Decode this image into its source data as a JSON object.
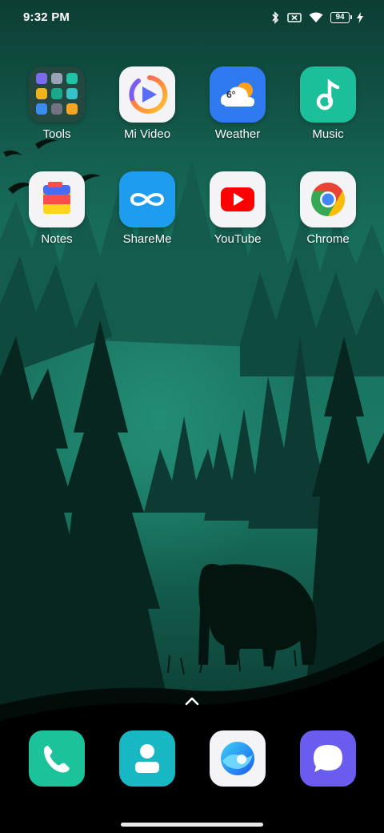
{
  "status_bar": {
    "time": "9:32 PM",
    "battery_level": "94",
    "icons": [
      "bluetooth-icon",
      "no-sim-icon",
      "wifi-icon",
      "battery-icon",
      "charging-icon"
    ]
  },
  "home": {
    "apps": [
      {
        "label": "Tools",
        "icon": "folder-icon"
      },
      {
        "label": "Mi Video",
        "icon": "mi-video-icon"
      },
      {
        "label": "Weather",
        "icon": "weather-icon",
        "temp": "6°"
      },
      {
        "label": "Music",
        "icon": "music-icon"
      },
      {
        "label": "Notes",
        "icon": "notes-icon"
      },
      {
        "label": "ShareMe",
        "icon": "shareme-icon"
      },
      {
        "label": "YouTube",
        "icon": "youtube-icon"
      },
      {
        "label": "Chrome",
        "icon": "chrome-icon"
      }
    ]
  },
  "dock": {
    "apps": [
      {
        "icon": "phone-icon"
      },
      {
        "icon": "contacts-icon"
      },
      {
        "icon": "browser-icon"
      },
      {
        "icon": "messages-icon"
      }
    ]
  },
  "colors": {
    "wallpaper_green": "#0e5a4a",
    "music": "#1bbf9a",
    "shareme": "#1e9cf0",
    "weather": "#2f7af0",
    "youtube_red": "#ff0000",
    "phone": "#1cc39a",
    "contacts": "#18b7c4",
    "messages": "#6b5cf0"
  }
}
